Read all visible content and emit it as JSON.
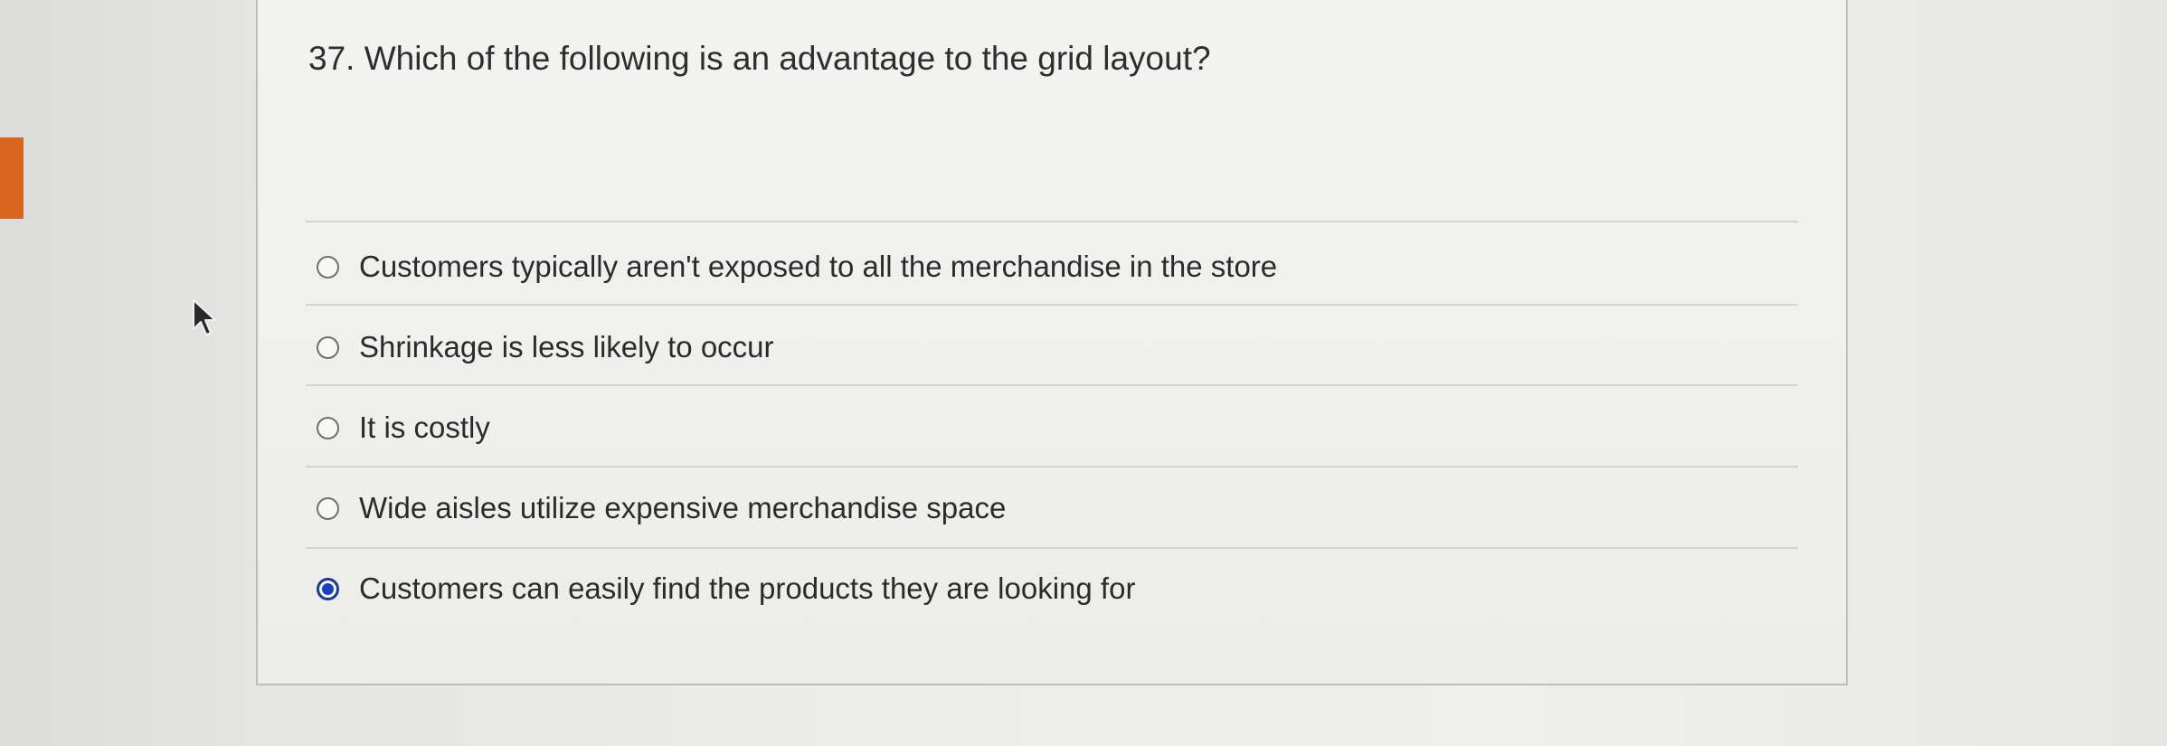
{
  "question": {
    "text": "37. Which of the following is an advantage to the grid layout?"
  },
  "options": [
    {
      "label": "Customers typically aren't exposed to all the merchandise in the store",
      "selected": false
    },
    {
      "label": "Shrinkage is less likely to occur",
      "selected": false
    },
    {
      "label": "It is costly",
      "selected": false
    },
    {
      "label": "Wide aisles utilize expensive merchandise space",
      "selected": false
    },
    {
      "label": "Customers can easily find the products they are looking for",
      "selected": true
    }
  ],
  "icons": {
    "cursor": "mouse-pointer-icon",
    "radio": "radio-button-icon"
  },
  "colors": {
    "accent_tab": "#d9661f",
    "radio_selected": "#1a3fc4"
  }
}
